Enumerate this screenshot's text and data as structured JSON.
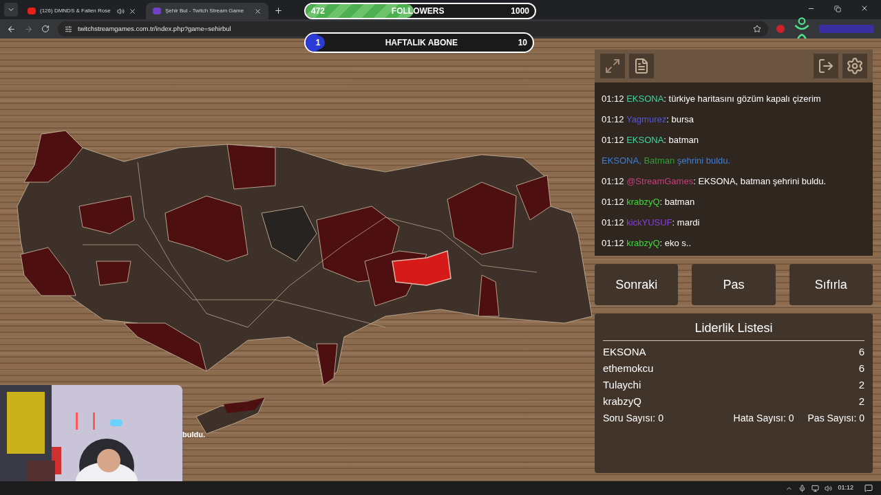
{
  "browser": {
    "tabs": [
      {
        "title": "(126) DMNDS & Fallen Rose",
        "selected": false,
        "audio": true
      },
      {
        "title": "Şehir Bul - Twitch Stream Game",
        "selected": true,
        "audio": false
      }
    ],
    "url": "twitchstreamgames.com.tr/index.php?game=sehirbul"
  },
  "followers": {
    "current": "472",
    "label": "FOLLOWERS",
    "goal": "1000",
    "level": 0.472
  },
  "subs": {
    "current": "1",
    "label": "HAFTALIK ABONE",
    "goal": "10",
    "level": 0.07
  },
  "chat": [
    {
      "kind": "message",
      "time": "01:12",
      "user": "EKSONA",
      "color": "#3ad6a0",
      "text": ": türkiye haritasını gözüm kapalı çizerim"
    },
    {
      "kind": "message",
      "time": "01:12",
      "user": "Yagmurez",
      "color": "#5555dd",
      "text": ": bursa"
    },
    {
      "kind": "message",
      "time": "01:12",
      "user": "EKSONA",
      "color": "#3ad6a0",
      "text": ": batman"
    },
    {
      "kind": "announce",
      "player": "EKSONA,",
      "city": "Batman",
      "rest": "şehrini buldu."
    },
    {
      "kind": "message",
      "time": "01:12",
      "user": "@StreamGames",
      "color": "#cc3d7a",
      "text": ": EKSONA, batman şehrini buldu."
    },
    {
      "kind": "message",
      "time": "01:12",
      "user": "krabzyQ",
      "color": "#3ed83e",
      "text": ": batman"
    },
    {
      "kind": "message",
      "time": "01:12",
      "user": "kickYUSUF",
      "color": "#8a3ee0",
      "text": ": mardi"
    },
    {
      "kind": "message",
      "time": "01:12",
      "user": "krabzyQ",
      "color": "#3ed83e",
      "text": ": eko s.."
    }
  ],
  "buttons": [
    "Sonraki",
    "Pas",
    "Sıfırla"
  ],
  "leaderboard": {
    "title": "Liderlik Listesi",
    "rows": [
      {
        "name": "EKSONA",
        "score": "6"
      },
      {
        "name": "ethemokcu",
        "score": "6"
      },
      {
        "name": "Tulaychi",
        "score": "2"
      },
      {
        "name": "krabzyQ",
        "score": "2"
      }
    ],
    "stats": [
      "Soru Sayısı: 0",
      "Hata Sayısı: 0",
      "Pas Sayısı: 0"
    ]
  },
  "map_caption": "buldu.",
  "webcam": {
    "kind": "picture"
  },
  "taskbar": {
    "time": "01:12"
  }
}
